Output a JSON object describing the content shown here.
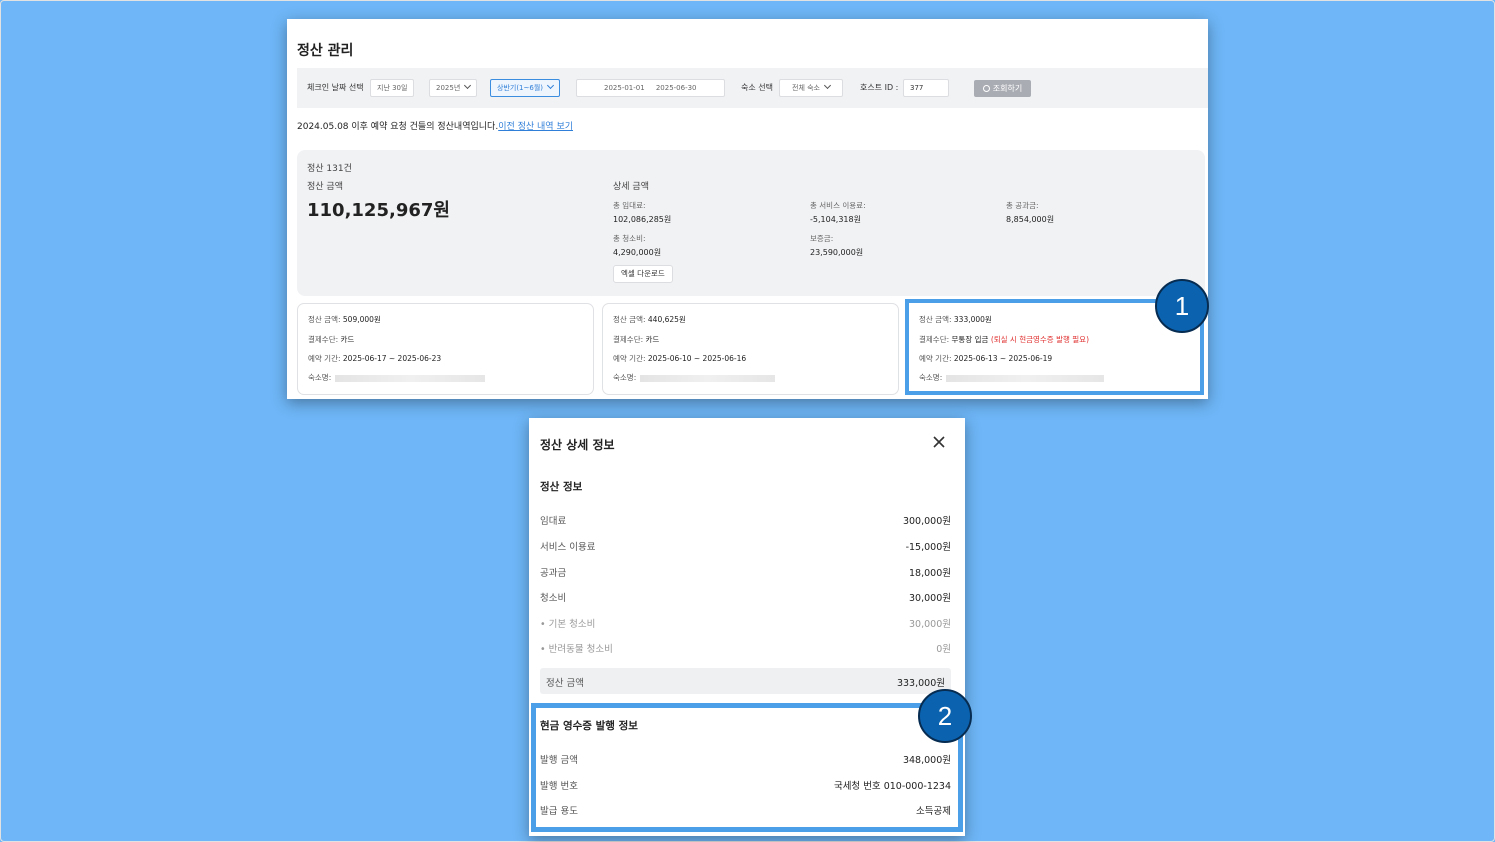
{
  "settlement_page": {
    "title": "정산 관리",
    "filters": {
      "checkin_label": "체크인 날짜 선택",
      "recent": "지난 30일",
      "year": "2025년",
      "half": "상반기(1~6월)",
      "date_from": "2025-01-01",
      "date_to": "2025-06-30",
      "lodging_label": "숙소 선택",
      "lodging_value": "전체 숙소",
      "host_label": "호스트 ID :",
      "host_value": "377",
      "search_button": "조회하기"
    },
    "notice_text": "2024.05.08 이후 예약 요청 건들의 정산내역입니다.",
    "notice_link": "이전 정산 내역 보기",
    "summary": {
      "count": "정산 131건",
      "amount_label": "정산 금액",
      "amount": "110,125,967원",
      "detail_label": "상세 금액",
      "details": [
        {
          "label": "총 임대료:",
          "value": "102,086,285원"
        },
        {
          "label": "총 서비스 이용료:",
          "value": "-5,104,318원"
        },
        {
          "label": "총 공과금:",
          "value": "8,854,000원"
        },
        {
          "label": "총 청소비:",
          "value": "4,290,000원"
        },
        {
          "label": "보증금:",
          "value": "23,590,000원"
        }
      ],
      "excel_button": "엑셀 다운로드"
    },
    "cards": [
      {
        "amount_label": "정산 금액:",
        "amount": "509,000원",
        "payment_label": "결제수단:",
        "payment": "카드",
        "payment_note": "",
        "period_label": "예약 기간:",
        "period": "2025-06-17 ~ 2025-06-23",
        "lodging_label": "숙소명:"
      },
      {
        "amount_label": "정산 금액:",
        "amount": "440,625원",
        "payment_label": "결제수단:",
        "payment": "카드",
        "payment_note": "",
        "period_label": "예약 기간:",
        "period": "2025-06-10 ~ 2025-06-16",
        "lodging_label": "숙소명:"
      },
      {
        "amount_label": "정산 금액:",
        "amount": "333,000원",
        "payment_label": "결제수단:",
        "payment": "무통장 입금",
        "payment_note": "(퇴실 시 현금영수증 발행 필요)",
        "period_label": "예약 기간:",
        "period": "2025-06-13 ~ 2025-06-19",
        "lodging_label": "숙소명:"
      }
    ]
  },
  "markers": [
    "1",
    "2"
  ],
  "detail_modal": {
    "title": "정산 상세 정보",
    "settlement_section": "정산 정보",
    "rows": [
      {
        "label": "임대료",
        "value": "300,000원"
      },
      {
        "label": "서비스 이용료",
        "value": "-15,000원"
      },
      {
        "label": "공과금",
        "value": "18,000원"
      },
      {
        "label": "청소비",
        "value": "30,000원"
      },
      {
        "label": "• 기본 청소비",
        "value": "30,000원"
      },
      {
        "label": "• 반려동물 청소비",
        "value": "0원"
      }
    ],
    "total_label": "정산 금액",
    "total_value": "333,000원",
    "receipt_section": "현금 영수증 발행 정보",
    "receipt_rows": [
      {
        "label": "발행 금액",
        "value": "348,000원"
      },
      {
        "label": "발행 번호",
        "value": "국세청 번호 010-000-1234"
      },
      {
        "label": "발급 용도",
        "value": "소득공제"
      }
    ]
  },
  "colors": {
    "background": "#6eb6f7",
    "highlight_border": "#4b9fe8",
    "marker": "#0b63b0",
    "link": "#2f7ed8",
    "warning": "#e03030"
  }
}
